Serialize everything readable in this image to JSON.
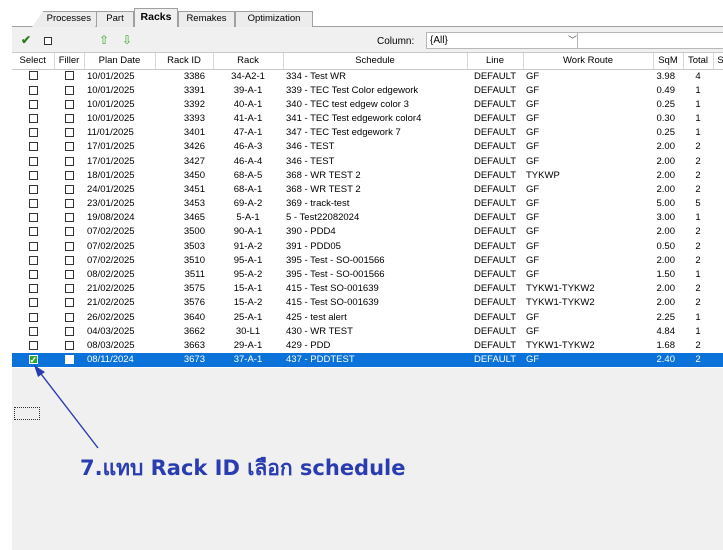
{
  "tabs": [
    {
      "label": "Processes",
      "active": false
    },
    {
      "label": "Part",
      "active": false
    },
    {
      "label": "Racks",
      "active": true
    },
    {
      "label": "Remakes",
      "active": false
    },
    {
      "label": "Optimization",
      "active": false
    }
  ],
  "toolbar": {
    "column_label": "Column:",
    "column_value": "{All}",
    "search_value": ""
  },
  "grid": {
    "columns": [
      "Select",
      "Filler",
      "Plan Date",
      "Rack ID",
      "Rack",
      "Schedule",
      "Line",
      "Work Route",
      "SqM",
      "Total",
      "S"
    ],
    "rows": [
      {
        "select": false,
        "filler": false,
        "plan_date": "10/01/2025",
        "rack_id": "3386",
        "rack": "34-A2-1",
        "schedule": "334 - Test WR",
        "line": "DEFAULT",
        "work_route": "GF",
        "sqm": "3.98",
        "total": "4"
      },
      {
        "select": false,
        "filler": false,
        "plan_date": "10/01/2025",
        "rack_id": "3391",
        "rack": "39-A-1",
        "schedule": "339 - TEC Test Color edgework",
        "line": "DEFAULT",
        "work_route": "GF",
        "sqm": "0.49",
        "total": "1"
      },
      {
        "select": false,
        "filler": false,
        "plan_date": "10/01/2025",
        "rack_id": "3392",
        "rack": "40-A-1",
        "schedule": "340 - TEC test edgew color 3",
        "line": "DEFAULT",
        "work_route": "GF",
        "sqm": "0.25",
        "total": "1"
      },
      {
        "select": false,
        "filler": false,
        "plan_date": "10/01/2025",
        "rack_id": "3393",
        "rack": "41-A-1",
        "schedule": "341 - TEC Test edgework color4",
        "line": "DEFAULT",
        "work_route": "GF",
        "sqm": "0.30",
        "total": "1"
      },
      {
        "select": false,
        "filler": false,
        "plan_date": "11/01/2025",
        "rack_id": "3401",
        "rack": "47-A-1",
        "schedule": "347 - TEC Test edgework 7",
        "line": "DEFAULT",
        "work_route": "GF",
        "sqm": "0.25",
        "total": "1"
      },
      {
        "select": false,
        "filler": false,
        "plan_date": "17/01/2025",
        "rack_id": "3426",
        "rack": "46-A-3",
        "schedule": "346 - TEST",
        "line": "DEFAULT",
        "work_route": "GF",
        "sqm": "2.00",
        "total": "2"
      },
      {
        "select": false,
        "filler": false,
        "plan_date": "17/01/2025",
        "rack_id": "3427",
        "rack": "46-A-4",
        "schedule": "346 - TEST",
        "line": "DEFAULT",
        "work_route": "GF",
        "sqm": "2.00",
        "total": "2"
      },
      {
        "select": false,
        "filler": false,
        "plan_date": "18/01/2025",
        "rack_id": "3450",
        "rack": "68-A-5",
        "schedule": "368 - WR TEST 2",
        "line": "DEFAULT",
        "work_route": "TYKWP",
        "sqm": "2.00",
        "total": "2"
      },
      {
        "select": false,
        "filler": false,
        "plan_date": "24/01/2025",
        "rack_id": "3451",
        "rack": "68-A-1",
        "schedule": "368 - WR TEST 2",
        "line": "DEFAULT",
        "work_route": "GF",
        "sqm": "2.00",
        "total": "2"
      },
      {
        "select": false,
        "filler": false,
        "plan_date": "23/01/2025",
        "rack_id": "3453",
        "rack": "69-A-2",
        "schedule": "369 - track-test",
        "line": "DEFAULT",
        "work_route": "GF",
        "sqm": "5.00",
        "total": "5"
      },
      {
        "select": false,
        "filler": false,
        "plan_date": "19/08/2024",
        "rack_id": "3465",
        "rack": "5-A-1",
        "schedule": "5 - Test22082024",
        "line": "DEFAULT",
        "work_route": "GF",
        "sqm": "3.00",
        "total": "1"
      },
      {
        "select": false,
        "filler": false,
        "plan_date": "07/02/2025",
        "rack_id": "3500",
        "rack": "90-A-1",
        "schedule": "390 - PDD4",
        "line": "DEFAULT",
        "work_route": "GF",
        "sqm": "2.00",
        "total": "2"
      },
      {
        "select": false,
        "filler": false,
        "plan_date": "07/02/2025",
        "rack_id": "3503",
        "rack": "91-A-2",
        "schedule": "391 - PDD05",
        "line": "DEFAULT",
        "work_route": "GF",
        "sqm": "0.50",
        "total": "2"
      },
      {
        "select": false,
        "filler": false,
        "plan_date": "07/02/2025",
        "rack_id": "3510",
        "rack": "95-A-1",
        "schedule": "395 - Test - SO-001566",
        "line": "DEFAULT",
        "work_route": "GF",
        "sqm": "2.00",
        "total": "2"
      },
      {
        "select": false,
        "filler": false,
        "plan_date": "08/02/2025",
        "rack_id": "3511",
        "rack": "95-A-2",
        "schedule": "395 - Test - SO-001566",
        "line": "DEFAULT",
        "work_route": "GF",
        "sqm": "1.50",
        "total": "1"
      },
      {
        "select": false,
        "filler": false,
        "plan_date": "21/02/2025",
        "rack_id": "3575",
        "rack": "15-A-1",
        "schedule": "415 - Test SO-001639",
        "line": "DEFAULT",
        "work_route": "TYKW1-TYKW2",
        "sqm": "2.00",
        "total": "2"
      },
      {
        "select": false,
        "filler": false,
        "plan_date": "21/02/2025",
        "rack_id": "3576",
        "rack": "15-A-2",
        "schedule": "415 - Test SO-001639",
        "line": "DEFAULT",
        "work_route": "TYKW1-TYKW2",
        "sqm": "2.00",
        "total": "2"
      },
      {
        "select": false,
        "filler": false,
        "plan_date": "26/02/2025",
        "rack_id": "3640",
        "rack": "25-A-1",
        "schedule": "425 - test alert",
        "line": "DEFAULT",
        "work_route": "GF",
        "sqm": "2.25",
        "total": "1"
      },
      {
        "select": false,
        "filler": false,
        "plan_date": "04/03/2025",
        "rack_id": "3662",
        "rack": "30-L1",
        "schedule": "430 - WR TEST",
        "line": "DEFAULT",
        "work_route": "GF",
        "sqm": "4.84",
        "total": "1"
      },
      {
        "select": false,
        "filler": false,
        "plan_date": "08/03/2025",
        "rack_id": "3663",
        "rack": "29-A-1",
        "schedule": "429 - PDD",
        "line": "DEFAULT",
        "work_route": "TYKW1-TYKW2",
        "sqm": "1.68",
        "total": "2"
      },
      {
        "select": true,
        "filler": false,
        "plan_date": "08/11/2024",
        "rack_id": "3673",
        "rack": "37-A-1",
        "schedule": "437 - PDDTEST",
        "line": "DEFAULT",
        "work_route": "GF",
        "sqm": "2.40",
        "total": "2",
        "highlighted": true
      }
    ]
  },
  "annotation": {
    "text": "7.แทบ Rack ID  เลือก schedule",
    "color": "#2a3db0"
  },
  "colors": {
    "selection": "#0a72d8",
    "check_green": "#2bab2b"
  }
}
